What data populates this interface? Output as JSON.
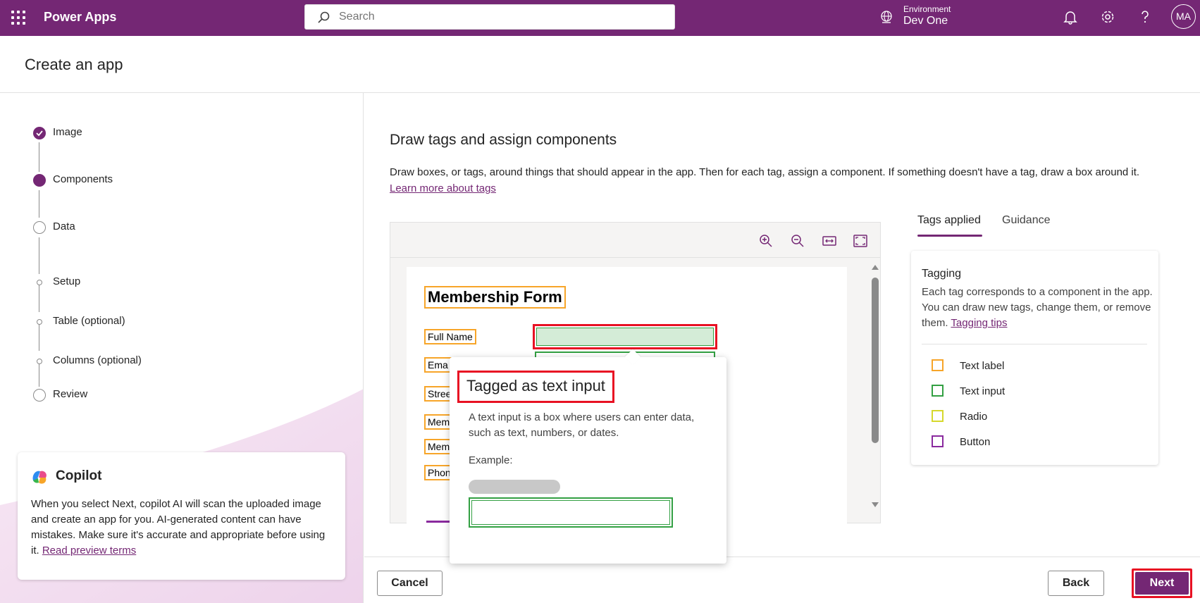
{
  "topbar": {
    "app_name": "Power Apps",
    "search_placeholder": "Search",
    "environment_label": "Environment",
    "environment_value": "Dev One",
    "avatar_initials": "MA",
    "brand_color": "#742774"
  },
  "header": {
    "title": "Create an app"
  },
  "steps": [
    {
      "label": "Image",
      "state": "completed"
    },
    {
      "label": "Components",
      "state": "current"
    },
    {
      "label": "Data",
      "state": "pending"
    },
    {
      "label": "Setup",
      "state": "substep"
    },
    {
      "label": "Table (optional)",
      "state": "substep"
    },
    {
      "label": "Columns (optional)",
      "state": "substep"
    },
    {
      "label": "Review",
      "state": "pending"
    }
  ],
  "copilot": {
    "title": "Copilot",
    "body": "When you select Next, copilot AI will scan the uploaded image and create an app for you. AI-generated content can have mistakes. Make sure it's accurate and appropriate before using it.",
    "link": "Read preview terms"
  },
  "main": {
    "title": "Draw tags and assign components",
    "description": "Draw boxes, or tags, around things that should appear in the app. Then for each tag, assign a component. If something doesn't have a tag, draw a box around it.",
    "learn_more": "Learn more about tags"
  },
  "canvas": {
    "toolbar": [
      "zoom-in",
      "zoom-out",
      "fit-width",
      "fit-page"
    ],
    "form_title": "Membership Form",
    "labels": [
      "Full Name",
      "Ema",
      "Stree",
      "Mem",
      "Mem",
      "Phon"
    ]
  },
  "tabs": [
    {
      "label": "Tags applied",
      "active": true
    },
    {
      "label": "Guidance",
      "active": false
    }
  ],
  "tagging": {
    "title": "Tagging",
    "body": "Each tag corresponds to a component in the app. You can draw new tags, change them, or remove them.",
    "link": "Tagging tips",
    "legend": [
      {
        "label": "Text label",
        "color": "#f7a529"
      },
      {
        "label": "Text input",
        "color": "#33a043"
      },
      {
        "label": "Radio",
        "color": "#d6d82c"
      },
      {
        "label": "Button",
        "color": "#8a2a9e"
      }
    ]
  },
  "popover": {
    "title": "Tagged as text input",
    "body": "A text input is a box where users can enter data, such as text, numbers, or dates.",
    "example_label": "Example:"
  },
  "footer": {
    "cancel": "Cancel",
    "back": "Back",
    "next": "Next"
  }
}
